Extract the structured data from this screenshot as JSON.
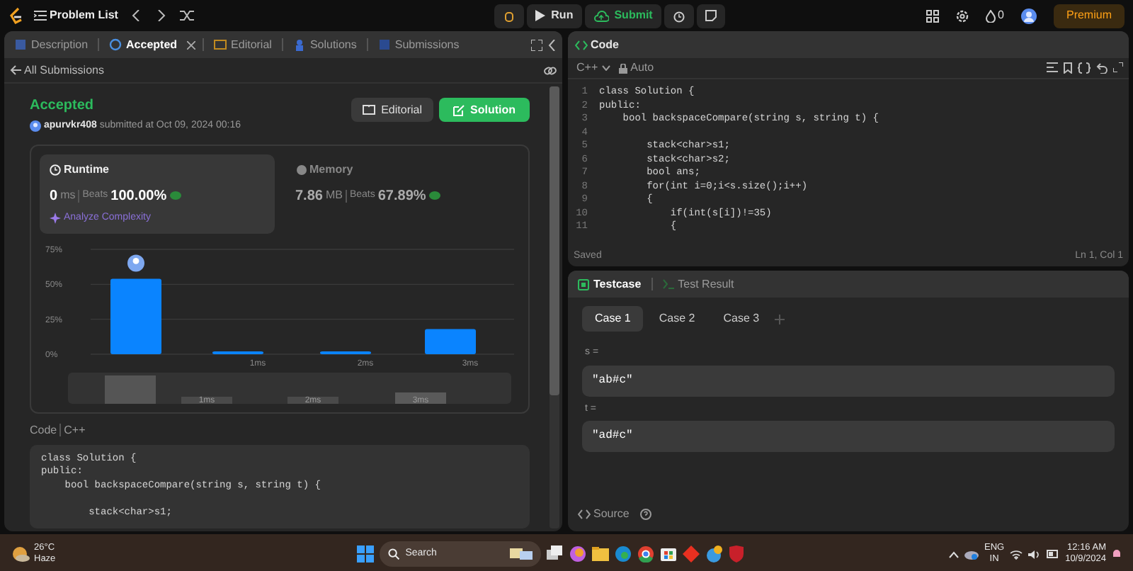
{
  "topbar": {
    "title": "Problem List",
    "run": "Run",
    "submit": "Submit",
    "streak": "0",
    "premium": "Premium"
  },
  "left_tabs": [
    {
      "label": "Description",
      "selected": false
    },
    {
      "label": "Accepted",
      "selected": true
    },
    {
      "label": "Editorial",
      "selected": false
    },
    {
      "label": "Solutions",
      "selected": false
    },
    {
      "label": "Submissions",
      "selected": false
    }
  ],
  "back_link": "All Submissions",
  "submission": {
    "status": "Accepted",
    "user": "apurvkr408",
    "submitted": "submitted at Oct 09, 2024 00:16",
    "editorial_button": "Editorial",
    "solution_button": "Solution"
  },
  "stats": [
    {
      "label": "Runtime",
      "value": "0",
      "unit": "ms",
      "beats_label": "Beats",
      "beats": "100.00%",
      "selected": true
    },
    {
      "label": "Memory",
      "value": "7.86",
      "unit": "MB",
      "beats_label": "Beats",
      "beats": "67.89%",
      "selected": false
    }
  ],
  "analyze": "Analyze Complexity",
  "chart_data": {
    "type": "bar",
    "categories": [
      null,
      "1ms",
      "2ms",
      "3ms"
    ],
    "values": [
      54,
      2,
      2,
      18
    ],
    "ylim": [
      0,
      75
    ],
    "yticks": [
      {
        "value": 0,
        "label": "0%"
      },
      {
        "value": 25,
        "label": "25%"
      },
      {
        "value": 50,
        "label": "50%"
      },
      {
        "value": 75,
        "label": "75%"
      }
    ]
  },
  "overview_labels": [
    "1ms",
    "2ms",
    "3ms"
  ],
  "code_view": {
    "label": "Code",
    "language": "C++",
    "lines": [
      {
        "kind": "code",
        "code": "class Solution {"
      },
      {
        "kind": "code",
        "code": "public:"
      },
      {
        "kind": "code",
        "code": "    bool backspaceCompare(string s, string t) {"
      },
      {
        "kind": "blank"
      },
      {
        "kind": "code",
        "code": "        stack<char>s1;"
      }
    ]
  },
  "editor": {
    "title": "Code",
    "language": "C++",
    "mode": "Auto",
    "lines": [
      {
        "number": "1",
        "code": "class Solution {"
      },
      {
        "number": "2",
        "code": "public:"
      },
      {
        "number": "3",
        "code": "    bool backspaceCompare(string s, string t) {"
      },
      {
        "number": "4"
      },
      {
        "number": "5",
        "code": "        stack<char>s1;"
      },
      {
        "number": "6",
        "code": "        stack<char>s2;"
      },
      {
        "number": "7",
        "code": "        bool ans;"
      },
      {
        "number": "8",
        "code": "        for(int i=0;i<s.size();i++)"
      },
      {
        "number": "9",
        "code": "        {"
      },
      {
        "number": "10",
        "code": "            if(int(s[i])!=35)"
      },
      {
        "number": "11",
        "code": "            {"
      }
    ],
    "status": "Saved",
    "cursor": "Ln 1, Col 1"
  },
  "testcase": {
    "tabs": [
      {
        "label": "Testcase",
        "selected": true
      },
      {
        "label": "Test Result",
        "selected": false
      }
    ],
    "cases": [
      {
        "label": "Case 1",
        "selected": true
      },
      {
        "label": "Case 2",
        "selected": false
      },
      {
        "label": "Case 3",
        "selected": false
      }
    ],
    "inputs": [
      {
        "name": "s =",
        "value": "\"ab#c\""
      },
      {
        "name": "t =",
        "value": "\"ad#c\""
      }
    ],
    "source": "Source"
  },
  "taskbar": {
    "temperature": "26°C",
    "weather": "Haze",
    "search": "Search",
    "language": "ENG",
    "region": "IN",
    "time": "12:16 AM",
    "date": "10/9/2024"
  }
}
